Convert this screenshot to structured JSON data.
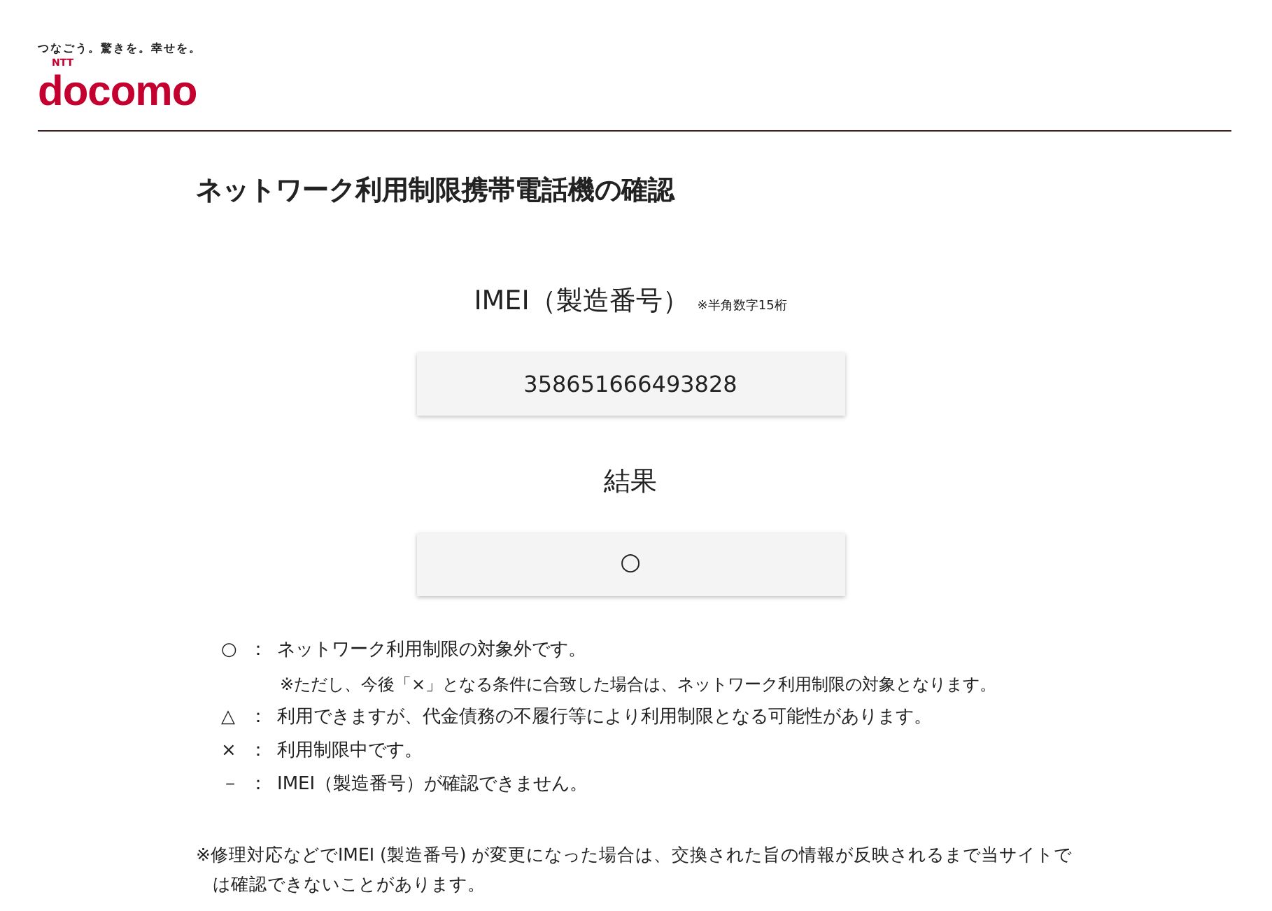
{
  "header": {
    "tagline": "つなごう。驚きを。幸せを。",
    "logo_small": "NTT",
    "logo": "docomo"
  },
  "title": "ネットワーク利用制限携帯電話機の確認",
  "imei": {
    "label": "IMEI（製造番号）",
    "hint": "※半角数字15桁",
    "value": "358651666493828"
  },
  "result": {
    "label": "結果",
    "value": "○"
  },
  "legend": [
    {
      "symbol": "○",
      "separator": "：",
      "text": "ネットワーク利用制限の対象外です。",
      "note": "※ただし、今後「×」となる条件に合致した場合は、ネットワーク利用制限の対象となります。"
    },
    {
      "symbol": "△",
      "separator": "：",
      "text": "利用できますが、代金債務の不履行等により利用制限となる可能性があります。"
    },
    {
      "symbol": "×",
      "separator": "：",
      "text": "利用制限中です。"
    },
    {
      "symbol": "－",
      "separator": "：",
      "text": "IMEI（製造番号）が確認できません。"
    }
  ],
  "footnote": "※修理対応などでIMEI (製造番号) が変更になった場合は、交換された旨の情報が反映されるまで当サイトでは確認できないことがあります。"
}
